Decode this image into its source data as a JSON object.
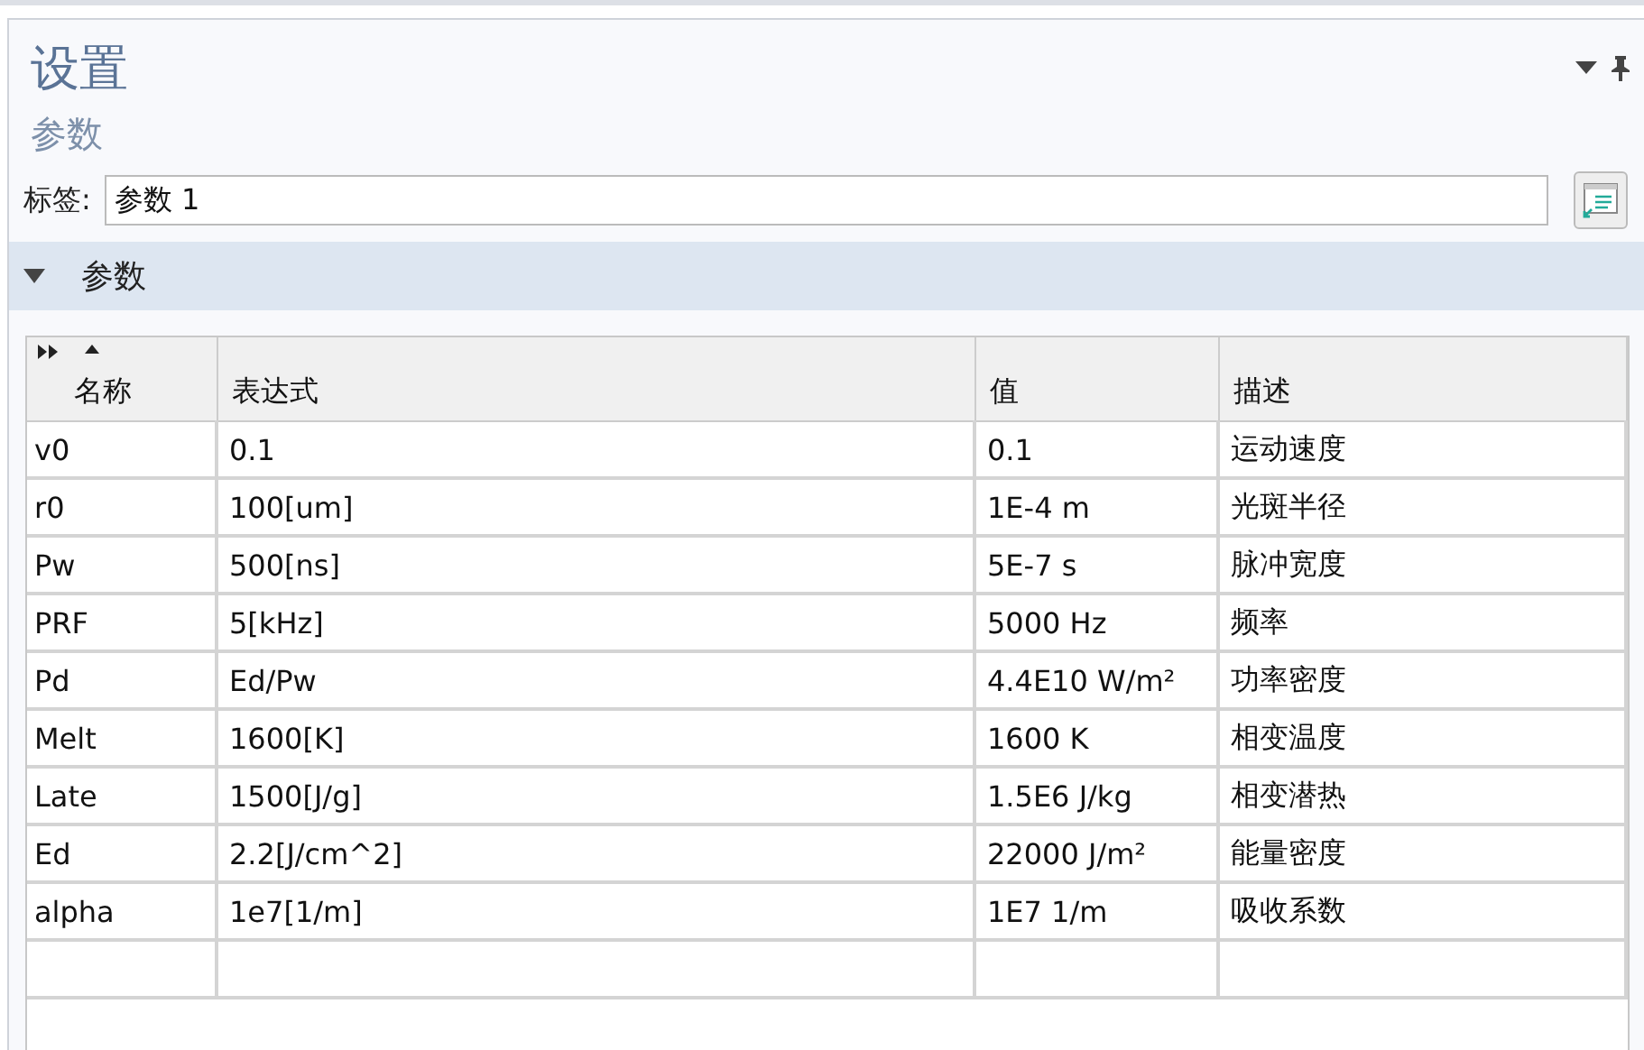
{
  "panel": {
    "title": "设置",
    "subtitle": "参数"
  },
  "label_field": {
    "label": "标签:",
    "value": "参数 1"
  },
  "section": {
    "title": "参数",
    "expanded": true
  },
  "table": {
    "columns": [
      "名称",
      "表达式",
      "值",
      "描述"
    ],
    "rows": [
      [
        "v0",
        "0.1",
        "0.1",
        "运动速度"
      ],
      [
        "r0",
        "100[um]",
        "1E-4 m",
        "光斑半径"
      ],
      [
        "Pw",
        "500[ns]",
        "5E-7 s",
        "脉冲宽度"
      ],
      [
        "PRF",
        "5[kHz]",
        "5000 Hz",
        "频率"
      ],
      [
        "Pd",
        "Ed/Pw",
        "4.4E10 W/m²",
        "功率密度"
      ],
      [
        "Melt",
        "1600[K]",
        "1600 K",
        "相变温度"
      ],
      [
        "Late",
        "1500[J/g]",
        "1.5E6 J/kg",
        "相变潜热"
      ],
      [
        "Ed",
        "2.2[J/cm^2]",
        "22000 J/m²",
        "能量密度"
      ],
      [
        "alpha",
        "1e7[1/m]",
        "1E7 1/m",
        "吸收系数"
      ]
    ]
  }
}
